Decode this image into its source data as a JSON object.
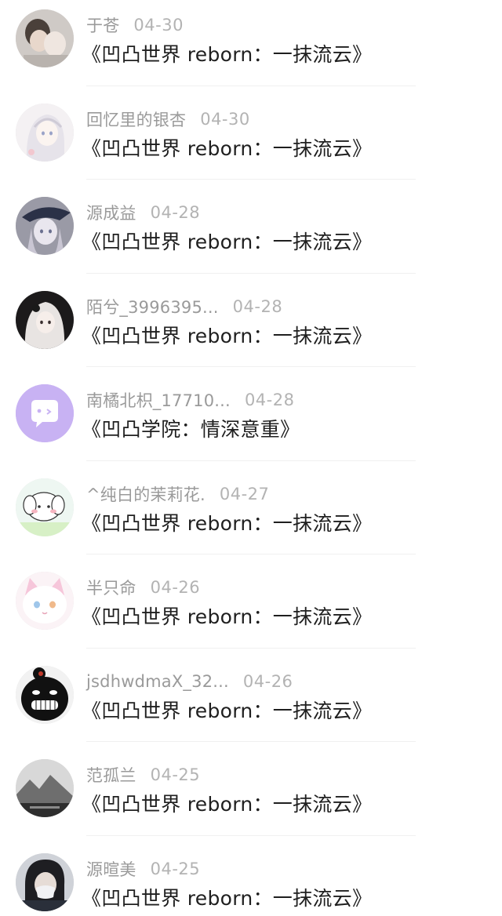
{
  "list": [
    {
      "name": "于苍",
      "date": "04-30",
      "title": "《凹凸世界 reborn：一抹流云》",
      "avatar": "photo-avatar-couple"
    },
    {
      "name": "回忆里的银杏",
      "date": "04-30",
      "title": "《凹凸世界 reborn：一抹流云》",
      "avatar": "anime-girl-white-hair-avatar"
    },
    {
      "name": "源成益",
      "date": "04-28",
      "title": "《凹凸世界 reborn：一抹流云》",
      "avatar": "anime-witch-hat-avatar"
    },
    {
      "name": "陌兮_3996395...",
      "date": "04-28",
      "title": "《凹凸世界 reborn：一抹流云》",
      "avatar": "anime-dark-girl-avatar"
    },
    {
      "name": "南橘北枳_17710...",
      "date": "04-28",
      "title": "《凹凸学院：情深意重》",
      "avatar": "default-chat-bubble-avatar"
    },
    {
      "name": "^纯白的茉莉花.",
      "date": "04-27",
      "title": "《凹凸世界 reborn：一抹流云》",
      "avatar": "cartoon-puppy-avatar"
    },
    {
      "name": "半只命",
      "date": "04-26",
      "title": "《凹凸世界 reborn：一抹流云》",
      "avatar": "white-cat-avatar"
    },
    {
      "name": "jsdhwdmaX_32...",
      "date": "04-26",
      "title": "《凹凸世界 reborn：一抹流云》",
      "avatar": "grinning-meme-avatar"
    },
    {
      "name": "范孤兰",
      "date": "04-25",
      "title": "《凹凸世界 reborn：一抹流云》",
      "avatar": "grey-landscape-avatar"
    },
    {
      "name": "源暄美",
      "date": "04-25",
      "title": "《凹凸世界 reborn：一抹流云》",
      "avatar": "masked-person-photo-avatar"
    }
  ],
  "colors": {
    "name": "#9a9a9a",
    "date": "#b3b3b3",
    "title": "#1f1f1f",
    "divider": "#f0f0f0",
    "default_avatar_bg": "#c8b2f3"
  }
}
